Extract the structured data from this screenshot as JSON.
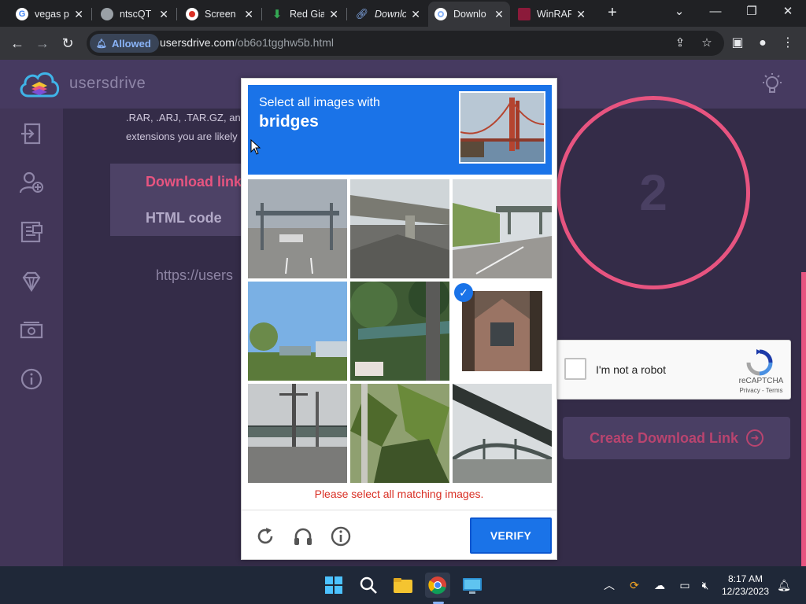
{
  "browser": {
    "tabs": [
      {
        "label": "vegas p",
        "icon": "google-icon"
      },
      {
        "label": "ntscQT",
        "icon": "globe-icon"
      },
      {
        "label": "Screen",
        "icon": "record-icon"
      },
      {
        "label": "Red Gia",
        "icon": "download-arrow-icon"
      },
      {
        "label": "Downlo",
        "icon": "link-icon"
      },
      {
        "label": "Downlo",
        "icon": "drive-icon",
        "active": true
      },
      {
        "label": "WinRAR",
        "icon": "winrar-icon"
      }
    ],
    "permission_chip": "Allowed",
    "url_host": "usersdrive.com",
    "url_path": "/ob6o1tgghw5b.html"
  },
  "site": {
    "brand": "usersdrive",
    "explain_text": ".RAR, .ARJ, .TAR.GZ, and . extensions you are likely",
    "tab_download_link": "Download link",
    "tab_html_code": "HTML code",
    "url_field_value": "https://users",
    "step_number": "2",
    "create_button": "Create Download Link",
    "accent_color": "#e75480",
    "sidebar_icons": [
      "login-icon",
      "add-user-icon",
      "files-icon",
      "diamond-icon",
      "money-icon",
      "info-icon"
    ]
  },
  "recaptcha": {
    "checkbox_label": "I'm not a robot",
    "brand": "reCAPTCHA",
    "terms": "Privacy - Terms"
  },
  "challenge": {
    "prompt": "Select all images with",
    "target": "bridges",
    "error": "Please select all matching images.",
    "verify_label": "VERIFY",
    "header_color": "#1a73e8",
    "tiles_selected": [
      false,
      false,
      false,
      false,
      false,
      true,
      false,
      false,
      false
    ]
  },
  "taskbar": {
    "time": "8:17 AM",
    "date": "12/23/2023"
  }
}
